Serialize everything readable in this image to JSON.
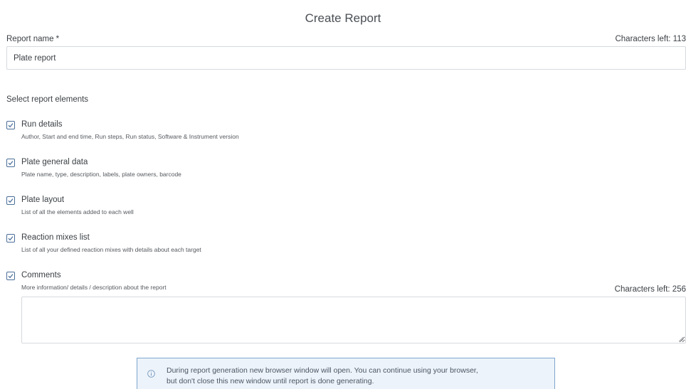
{
  "dialog": {
    "title": "Create Report"
  },
  "report_name": {
    "label": "Report name *",
    "characters_left": "Characters left: 113",
    "value": "Plate report"
  },
  "elements": {
    "section_label": "Select report elements",
    "options": [
      {
        "label": "Run details",
        "description": "Author, Start and end time, Run steps, Run status, Software & Instrument version",
        "checked": true
      },
      {
        "label": "Plate general data",
        "description": "Plate name, type, description, labels, plate owners, barcode",
        "checked": true
      },
      {
        "label": "Plate layout",
        "description": "List of all the elements added to each well",
        "checked": true
      },
      {
        "label": "Reaction mixes list",
        "description": "List of all your defined reaction mixes with details about each target",
        "checked": true
      },
      {
        "label": "Comments",
        "description": "More information/ details / description about the report",
        "checked": true
      }
    ]
  },
  "comments": {
    "characters_left": "Characters left: 256",
    "value": ""
  },
  "info": {
    "icon": "info-icon",
    "line1": "During report generation new browser window will open. You can continue using your browser,",
    "line2": "but don't close this new window until report is done generating."
  },
  "colors": {
    "checkbox_border": "#4a6e99",
    "info_background": "#edf3fa",
    "info_border": "#7fa6cf",
    "input_border": "#d6dade"
  }
}
